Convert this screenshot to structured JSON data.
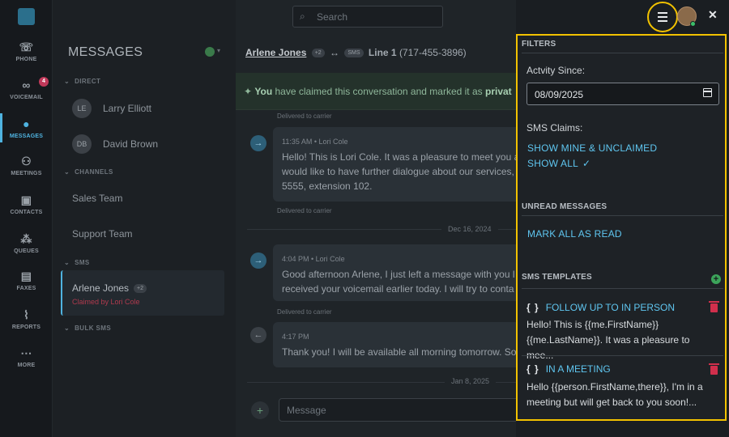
{
  "rail": {
    "items": [
      {
        "label": "PHONE",
        "icon": "phone-icon"
      },
      {
        "label": "VOICEMAIL",
        "icon": "voicemail-icon",
        "badge": "4"
      },
      {
        "label": "MESSAGES",
        "icon": "messages-icon",
        "active": true
      },
      {
        "label": "MEETINGS",
        "icon": "meetings-icon"
      },
      {
        "label": "CONTACTS",
        "icon": "contacts-icon"
      },
      {
        "label": "QUEUES",
        "icon": "queues-icon"
      },
      {
        "label": "FAXES",
        "icon": "faxes-icon"
      },
      {
        "label": "REPORTS",
        "icon": "reports-icon"
      },
      {
        "label": "MORE",
        "icon": "more-icon"
      }
    ]
  },
  "search": {
    "placeholder": "Search"
  },
  "list": {
    "title": "MESSAGES",
    "sections": {
      "direct": "DIRECT",
      "channels": "CHANNELS",
      "sms": "SMS",
      "bulk_sms": "BULK SMS"
    },
    "direct": [
      {
        "initials": "LE",
        "name": "Larry Elliott"
      },
      {
        "initials": "DB",
        "name": "David Brown"
      }
    ],
    "channels": [
      "Sales Team",
      "Support Team"
    ],
    "sms_selected": {
      "name": "Arlene Jones",
      "extra": "+2",
      "claim": "Claimed by Lori Cole"
    }
  },
  "conversation": {
    "contact": "Arlene Jones",
    "extra": "+2",
    "sms_tag": "SMS",
    "line": "Line 1",
    "phone": "(717-455-3896)",
    "banner_bold": "You",
    "banner_text": " have claimed this conversation and marked it as ",
    "banner_end": "privat",
    "messages": [
      {
        "header": "11:35 AM • Lori Cole",
        "body": "Hello! This is Lori Cole. It was a pleasure to meet you a would like to have further dialogue about our services, 5555, extension 102."
      },
      {
        "header": "4:04 PM • Lori Cole",
        "body": "Good afternoon Arlene, I just left a message with you l received your voicemail earlier today. I will try to conta"
      },
      {
        "header": "4:17 PM",
        "body": "Thank you! I will be available all morning tomorrow. So"
      }
    ],
    "delivered": "Delivered to carrier",
    "dates": [
      "Dec 16, 2024",
      "Jan 8, 2025"
    ],
    "compose_placeholder": "Message"
  },
  "filters": {
    "title": "FILTERS",
    "activity_label": "Actvity Since:",
    "activity_value": "08/09/2025",
    "sms_claims_label": "SMS Claims:",
    "show_mine": "SHOW MINE & UNCLAIMED",
    "show_all": "SHOW ALL",
    "show_all_check": "✓",
    "unread_title": "UNREAD MESSAGES",
    "mark_all": "MARK ALL AS READ",
    "templates_title": "SMS TEMPLATES",
    "templates": [
      {
        "title": "FOLLOW UP TO IN PERSON",
        "body": "Hello! This is {{me.FirstName}} {{me.LastName}}. It was a pleasure to mee..."
      },
      {
        "title": "IN A MEETING",
        "body": "Hello {{person.FirstName,there}}, I'm in a meeting but will get back to you soon!..."
      }
    ],
    "braces": "{ }"
  },
  "colors": {
    "accent": "#5fc6f0",
    "highlight": "#f2c200",
    "danger": "#d12f4c",
    "success": "#3ca45a"
  }
}
